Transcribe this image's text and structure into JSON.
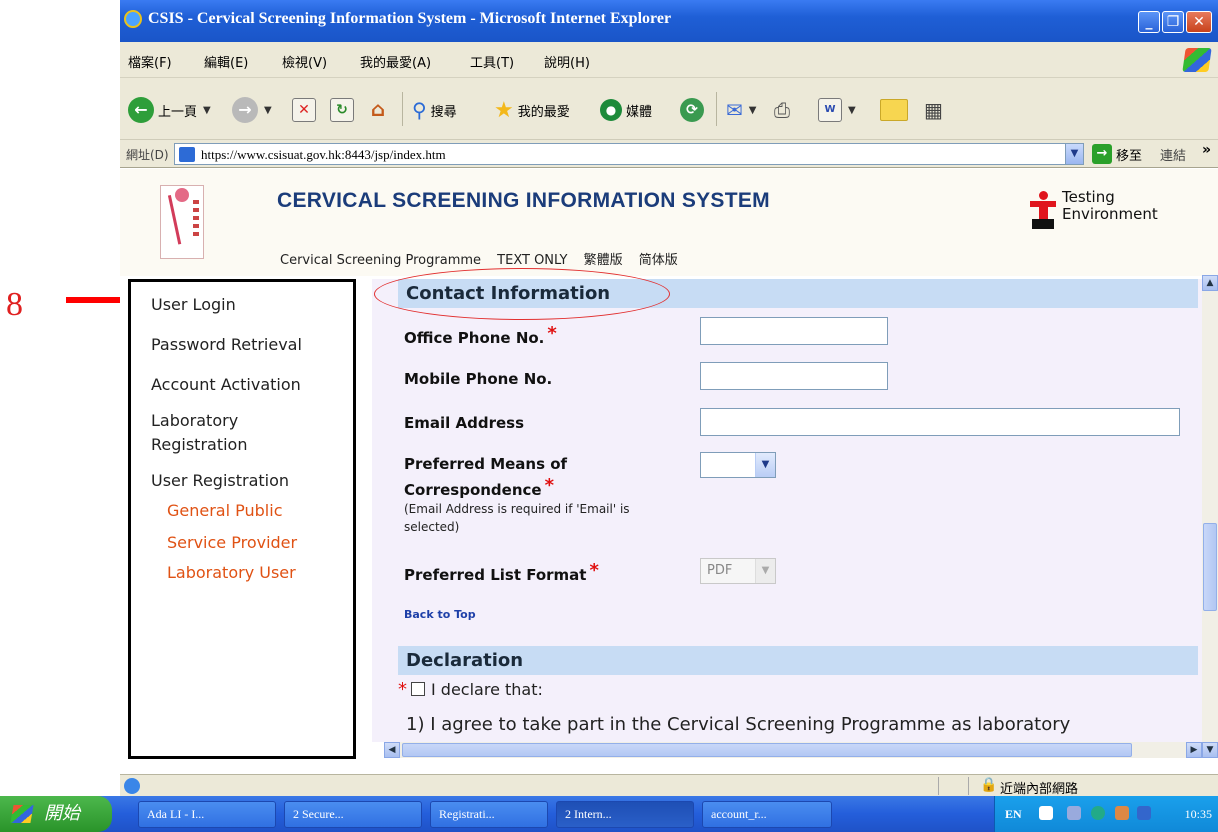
{
  "annotation": {
    "number": "8"
  },
  "window": {
    "title": "CSIS - Cervical Screening Information System - Microsoft Internet Explorer",
    "controls": {
      "min": "_",
      "max": "❐",
      "close": "✕"
    }
  },
  "menubar": {
    "items": [
      "檔案(F)",
      "編輯(E)",
      "檢視(V)",
      "我的最愛(A)",
      "工具(T)",
      "說明(H)"
    ]
  },
  "toolbar": {
    "back_label": "上一頁",
    "search_label": "搜尋",
    "favorites_label": "我的最愛",
    "media_label": "媒體"
  },
  "addressbar": {
    "label": "網址(D)",
    "url": "https://www.csisuat.gov.hk:8443/jsp/index.htm",
    "go_label": "移至",
    "links_label": "連結",
    "more": "»"
  },
  "header": {
    "system_name": "CERVICAL SCREENING INFORMATION SYSTEM",
    "links": [
      "Cervical Screening Programme",
      "TEXT ONLY",
      "繁體版",
      "简体版"
    ],
    "testing_line1": "Testing",
    "testing_line2": "Environment"
  },
  "sidebar": {
    "items": [
      "User Login",
      "Password Retrieval",
      "Account Activation",
      "Laboratory",
      "Registration",
      "User Registration"
    ],
    "sub_items": [
      "General Public",
      "Service Provider",
      "Laboratory User"
    ]
  },
  "form": {
    "contact_header": "Contact Information",
    "office_phone_label": "Office Phone No.",
    "mobile_phone_label": "Mobile Phone No.",
    "email_label": "Email Address",
    "pref_means_label_1": "Preferred Means of",
    "pref_means_label_2": "Correspondence",
    "email_note_1": "(Email Address is required if 'Email' is",
    "email_note_2": "selected)",
    "pref_list_label": "Preferred List Format",
    "pref_list_value": "PDF",
    "required_mark": "*",
    "back_to_top": "Back to Top",
    "declaration_header": "Declaration",
    "declare_text": "I declare that:",
    "declare_item_1": "1) I agree to take part in the Cervical Screening Programme as laboratory"
  },
  "statusbar": {
    "zone": "近端內部網路"
  },
  "taskbar": {
    "start_label": "開始",
    "tasks": [
      "Ada LI - I...",
      "2 Secure...",
      "Registrati...",
      "2 Intern...",
      "account_r..."
    ],
    "lang": "EN",
    "clock": "10:35"
  }
}
